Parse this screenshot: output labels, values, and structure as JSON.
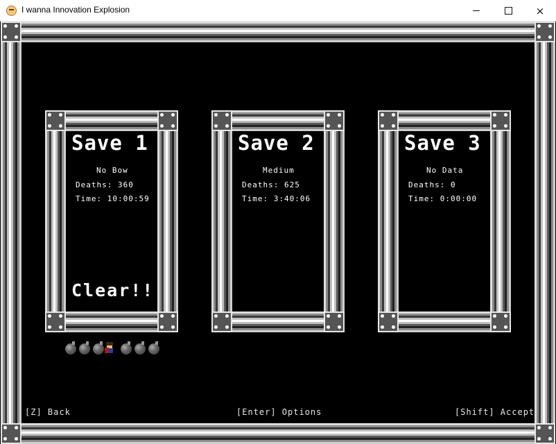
{
  "window": {
    "title": "I wanna Innovation Explosion",
    "icon": "app-face-icon",
    "buttons": {
      "minimize": "minimize-icon",
      "maximize": "maximize-icon",
      "close": "×"
    }
  },
  "saves": [
    {
      "title": "Save 1",
      "difficulty": "No Bow",
      "deaths": "Deaths: 360",
      "time": "Time: 10:00:59",
      "status": "Clear!!"
    },
    {
      "title": "Save 2",
      "difficulty": "Medium",
      "deaths": "Deaths: 625",
      "time": "Time: 3:40:06",
      "status": ""
    },
    {
      "title": "Save 3",
      "difficulty": "No Data",
      "deaths": "Deaths: 0",
      "time": "Time: 0:00:00",
      "status": ""
    }
  ],
  "save1_items": [
    "bomb",
    "bomb",
    "bomb",
    "kid",
    "bomb",
    "bomb",
    "bomb"
  ],
  "footer": {
    "back": "[Z] Back",
    "options": "[Enter] Options",
    "accept": "[Shift] Accept"
  },
  "colors": {
    "background": "#000000",
    "text": "#ffffff",
    "metal_light": "#dcdcdc",
    "metal_dark": "#3a3a3a"
  }
}
